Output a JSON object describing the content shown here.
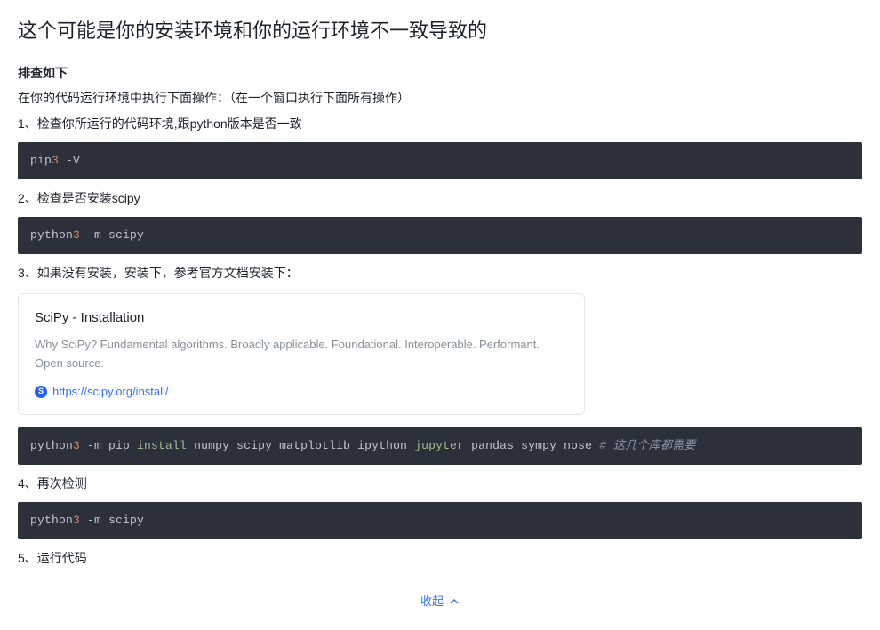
{
  "title": "这个可能是你的安装环境和你的运行环境不一致导致的",
  "sectionLabel": "排查如下",
  "intro1": "在你的代码运行环境中执行下面操作：（在一个窗口执行下面所有操作）",
  "step1": "1、检查你所运行的代码环境,跟python版本是否一致",
  "code1": {
    "cmd": "pip",
    "num": "3",
    "flag": " -V"
  },
  "step2": "2、检查是否安装scipy",
  "code2": {
    "cmd": "python",
    "num": "3",
    "rest": " -m scipy"
  },
  "step3": "3、如果没有安装，安装下，参考官方文档安装下：",
  "linkCard": {
    "title": "SciPy - Installation",
    "desc": "Why SciPy? Fundamental algorithms. Broadly applicable. Foundational. Interoperable. Performant. Open source.",
    "favicon": "S",
    "url": "https://scipy.org/install/"
  },
  "code3": {
    "pre": "python",
    "num": "3",
    "mid1": " -m pip ",
    "install": "install",
    "mid2": " numpy scipy matplotlib ipython ",
    "jupyter": "jupyter",
    "mid3": " pandas sympy nose ",
    "commenthash": "# ",
    "comment": "这几个库都需要"
  },
  "step4": "4、再次检测",
  "code4": {
    "cmd": "python",
    "num": "3",
    "rest": " -m scipy"
  },
  "step5": "5、运行代码",
  "collapseLabel": "收起"
}
